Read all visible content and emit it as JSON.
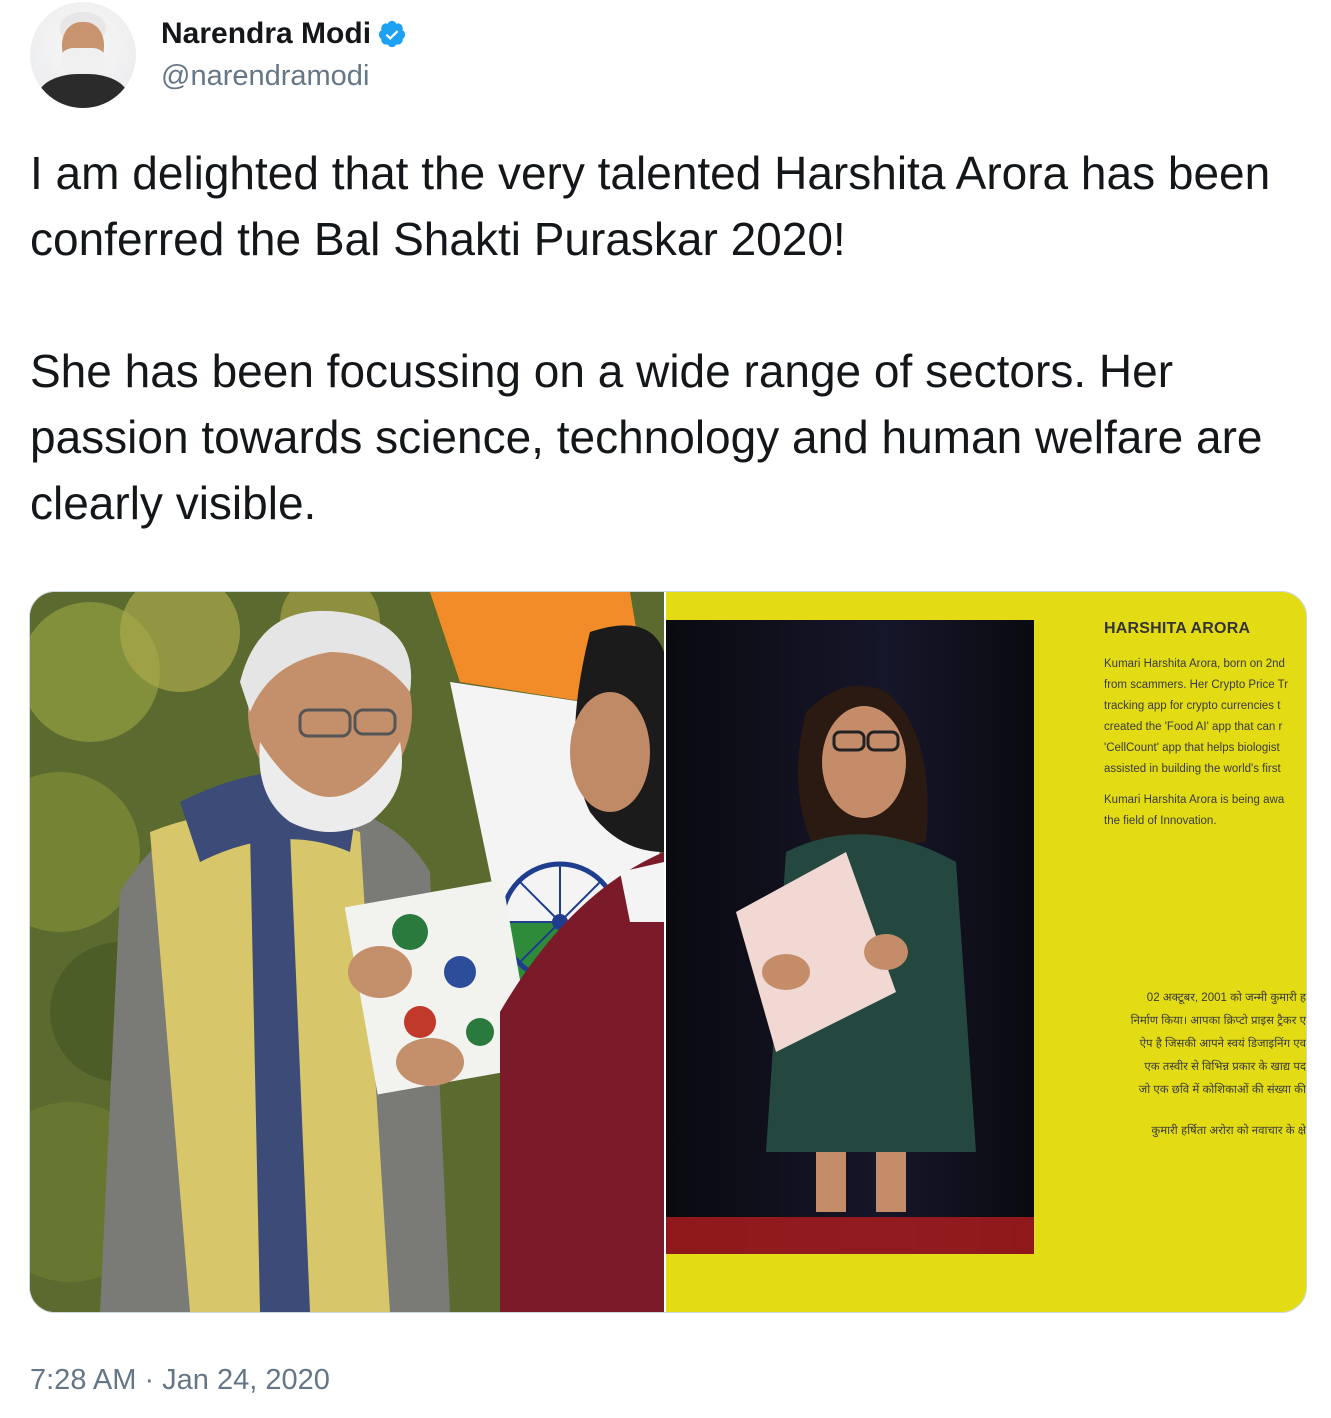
{
  "author": {
    "display_name": "Narendra Modi",
    "handle": "@narendramodi",
    "verified": true,
    "avatar_icon": "profile-photo-avatar",
    "verified_icon": "verified-badge-icon",
    "verified_color": "#1da1f2"
  },
  "tweet": {
    "paragraphs": [
      "I am delighted that the very talented Harshita Arora has been conferred the Bal Shakti Puraskar 2020!",
      "She has been focussing on a wide range of sectors. Her passion towards science, technology and human welfare are clearly visible."
    ],
    "timestamp": "7:28 AM · Jan 24, 2020"
  },
  "media": {
    "photo_right": {
      "card_title": "HARSHITA ARORA",
      "card_english_lines": [
        "Kumari Harshita Arora, born on 2nd",
        "from scammers. Her Crypto Price Tr",
        "tracking app for crypto currencies t",
        "created the 'Food AI' app that can r",
        "'CellCount' app that helps biologist",
        "assisted in building the world's first"
      ],
      "card_english_lines_2": [
        "Kumari Harshita Arora is being awa",
        "the field of Innovation."
      ],
      "card_hindi_lines": [
        "02 अक्टूबर, 2001 को जन्मी कुमारी ह",
        "निर्माण किया। आपका क्रिप्टो प्राइस ट्रैकर ए",
        "ऐप है जिसकी आपने स्वयं डिजाइनिंग एव",
        "एक तस्वीर से विभिन्न प्रकार के खाद्य पद",
        "जो एक छवि में कोशिकाओं की संख्या की"
      ],
      "card_hindi_lines_2": [
        "कुमारी हर्षिता अरोरा को नवाचार के क्षे"
      ],
      "card_background_color": "#e3dc15"
    }
  }
}
